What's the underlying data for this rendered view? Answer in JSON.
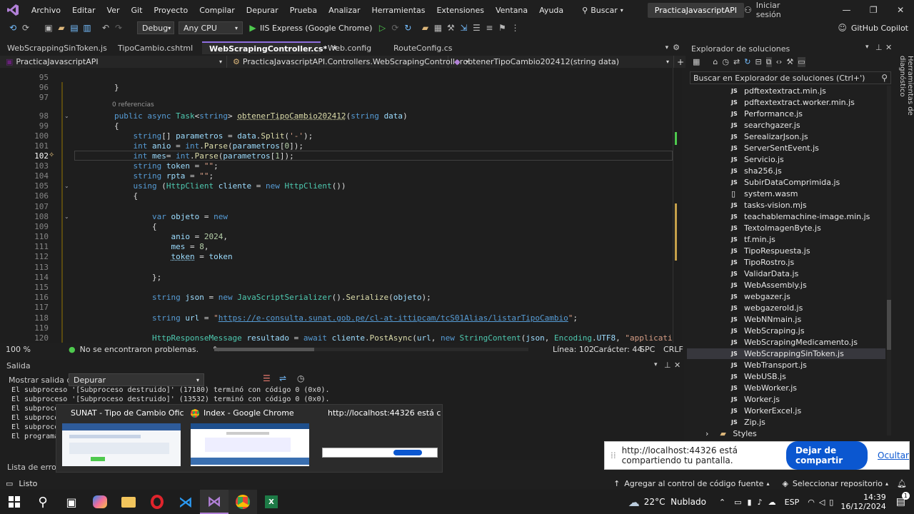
{
  "menu": [
    "Archivo",
    "Editar",
    "Ver",
    "Git",
    "Proyecto",
    "Compilar",
    "Depurar",
    "Prueba",
    "Analizar",
    "Herramientas",
    "Extensiones",
    "Ventana",
    "Ayuda"
  ],
  "search_label": "Buscar",
  "solution_title": "PracticaJavascriptAPI",
  "signin": "Iniciar sesión",
  "toolbar": {
    "config": "Debug",
    "platform": "Any CPU",
    "run_target": "IIS Express (Google Chrome)",
    "copilot": "GitHub Copilot"
  },
  "tabs": [
    {
      "label": "WebScrappingSinToken.js",
      "active": false
    },
    {
      "label": "TipoCambio.cshtml",
      "active": false
    },
    {
      "label": "WebScrapingController.cs*",
      "active": true
    },
    {
      "label": "Web.config",
      "active": false
    },
    {
      "label": "RouteConfig.cs",
      "active": false
    }
  ],
  "nav": {
    "project": "PracticaJavascriptAPI",
    "class": "PracticaJavascriptAPI.Controllers.WebScrapingController",
    "method": "obtenerTipoCambio202412(string data)"
  },
  "code": {
    "references": "0 referencias",
    "line_numbers": [
      "95",
      "96",
      "97",
      "98",
      "99",
      "100",
      "101",
      "102",
      "103",
      "104",
      "105",
      "106",
      "107",
      "108",
      "109",
      "110",
      "111",
      "112",
      "113",
      "114",
      "115",
      "116",
      "117",
      "118",
      "119",
      "120"
    ],
    "url": "https://e-consulta.sunat.gob.pe/cl-at-ittipcam/tcS01Alias/listarTipoCambio"
  },
  "editor_status": {
    "zoom": "100 %",
    "problems": "No se encontraron problemas.",
    "line": "Línea: 102",
    "char": "Carácter: 44",
    "spc": "SPC",
    "crlf": "CRLF"
  },
  "output": {
    "title": "Salida",
    "show_label": "Mostrar salida de:",
    "source": "Depurar",
    "lines": [
      "El subproceso '[Subproceso destruido]' (17180) terminó con código 0 (0x0).",
      "El subproceso '[Subproceso destruido]' (13532) terminó con código 0 (0x0).",
      "El subproces",
      "El subproces",
      "El subproces",
      "El programa"
    ],
    "error_list": "Lista de errores"
  },
  "previews": [
    {
      "title": "SUNAT - Tipo de Cambio Oficia..."
    },
    {
      "title": "Index - Google Chrome"
    },
    {
      "title": "http://localhost:44326 está com..."
    }
  ],
  "solution_explorer": {
    "title": "Explorador de soluciones",
    "search_placeholder": "Buscar en Explorador de soluciones (Ctrl+')",
    "items": [
      {
        "name": "pdftextextract.min.js",
        "icon": "JS"
      },
      {
        "name": "pdftextextract.worker.min.js",
        "icon": "JS"
      },
      {
        "name": "Performance.js",
        "icon": "JS"
      },
      {
        "name": "searchgazer.js",
        "icon": "JS"
      },
      {
        "name": "SerealizarJson.js",
        "icon": "JS"
      },
      {
        "name": "ServerSentEvent.js",
        "icon": "JS"
      },
      {
        "name": "Servicio.js",
        "icon": "JS"
      },
      {
        "name": "sha256.js",
        "icon": "JS"
      },
      {
        "name": "SubirDataComprimida.js",
        "icon": "JS"
      },
      {
        "name": "system.wasm",
        "icon": "file"
      },
      {
        "name": "tasks-vision.mjs",
        "icon": "JS"
      },
      {
        "name": "teachablemachine-image.min.js",
        "icon": "JS"
      },
      {
        "name": "TextoImagenByte.js",
        "icon": "JS"
      },
      {
        "name": "tf.min.js",
        "icon": "JS"
      },
      {
        "name": "TipoRespuesta.js",
        "icon": "JS"
      },
      {
        "name": "TipoRostro.js",
        "icon": "JS"
      },
      {
        "name": "ValidarData.js",
        "icon": "JS"
      },
      {
        "name": "WebAssembly.js",
        "icon": "JS"
      },
      {
        "name": "webgazer.js",
        "icon": "JS"
      },
      {
        "name": "webgazerold.js",
        "icon": "JS"
      },
      {
        "name": "WebNNmain.js",
        "icon": "JS"
      },
      {
        "name": "WebScraping.js",
        "icon": "JS"
      },
      {
        "name": "WebScrapingMedicamento.js",
        "icon": "JS"
      },
      {
        "name": "WebScrappingSinToken.js",
        "icon": "JS"
      },
      {
        "name": "WebTransport.js",
        "icon": "JS"
      },
      {
        "name": "WebUSB.js",
        "icon": "JS"
      },
      {
        "name": "WebWorker.js",
        "icon": "JS"
      },
      {
        "name": "Worker.js",
        "icon": "JS"
      },
      {
        "name": "WorkerExcel.js",
        "icon": "JS"
      },
      {
        "name": "Zip.js",
        "icon": "JS"
      },
      {
        "name": "Styles",
        "icon": "folder"
      }
    ]
  },
  "side_tab": "Herramientas de diagnóstico",
  "share": {
    "message": "http://localhost:44326 está compartiendo tu pantalla.",
    "stop": "Dejar de compartir",
    "hide": "Ocultar"
  },
  "statusbar": {
    "ready": "Listo",
    "source_control": "Agregar al control de código fuente",
    "repo": "Seleccionar repositorio"
  },
  "taskbar": {
    "weather": "22°C  Nublado",
    "lang": "ESP",
    "time": "14:39",
    "date": "16/12/2024",
    "notifications": "1"
  }
}
